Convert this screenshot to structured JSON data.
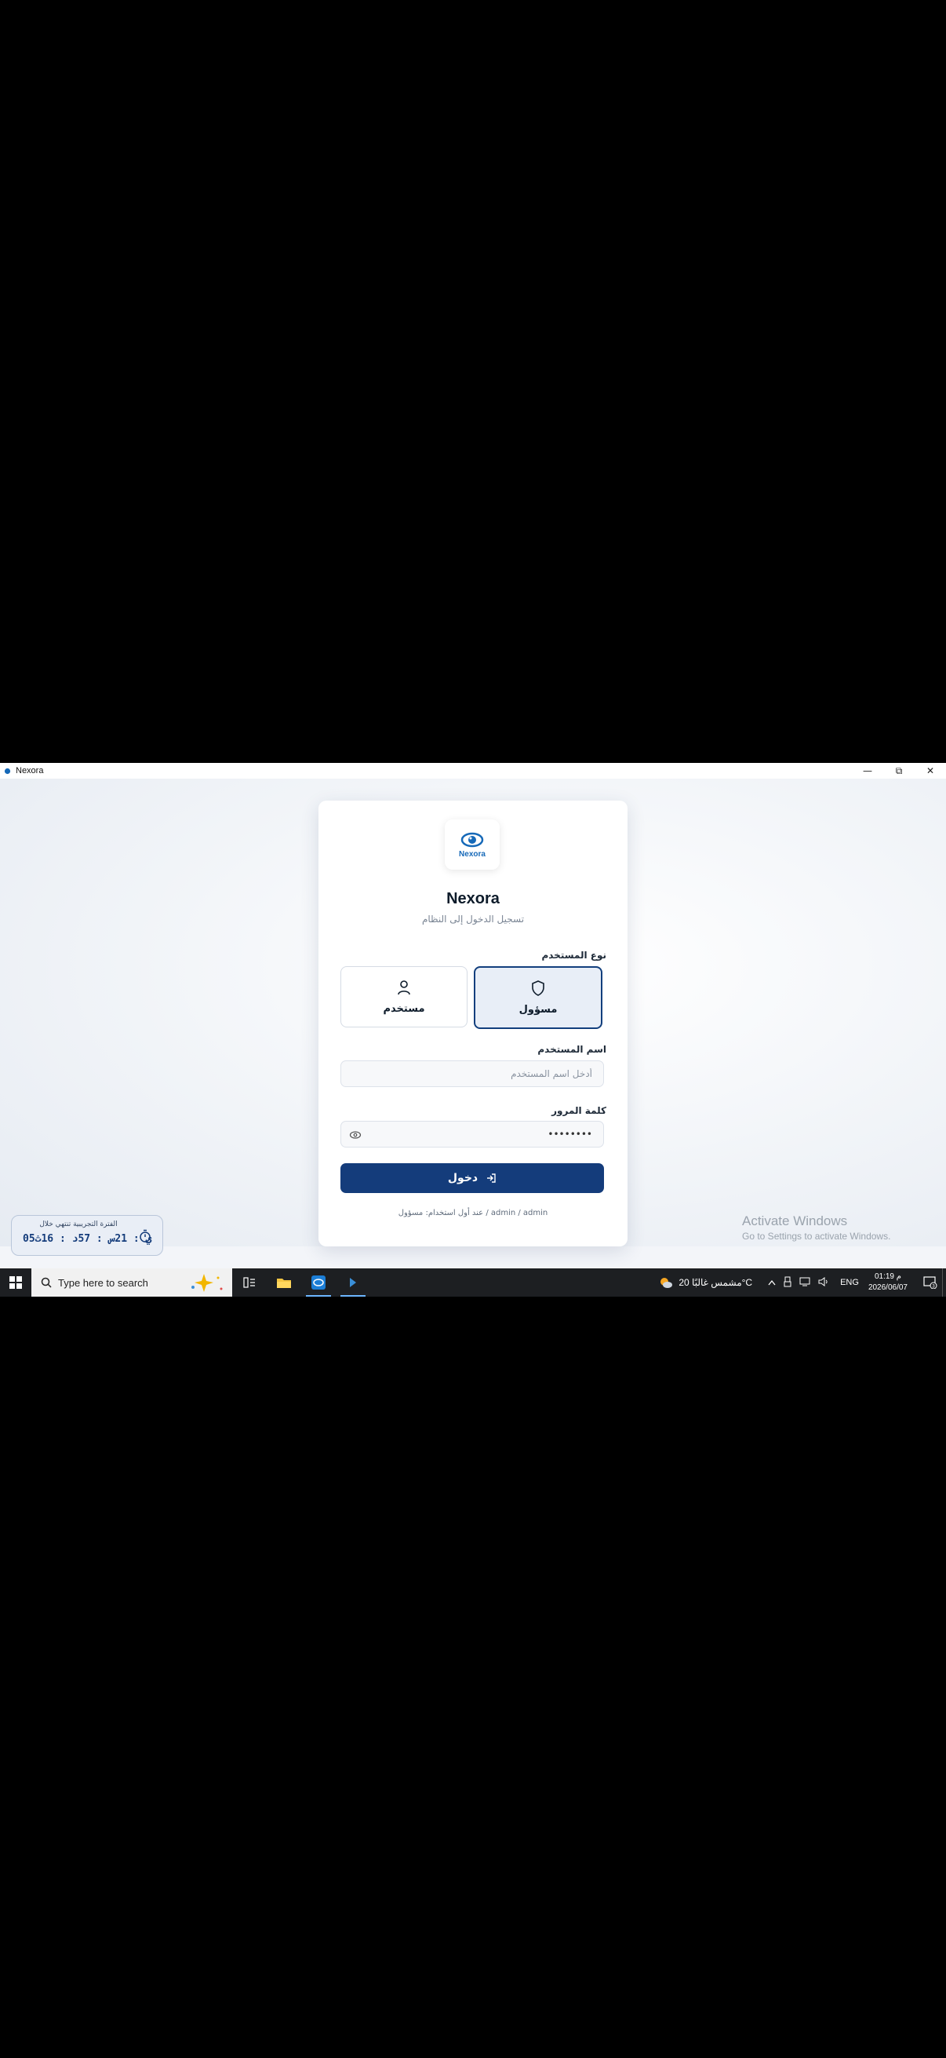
{
  "window": {
    "title": "Nexora",
    "minimize": "—",
    "maximize": "⧉",
    "close": "✕"
  },
  "brand": {
    "logo_text": "Nexora",
    "app_name": "Nexora",
    "subtitle": "تسجيل الدخول إلى النظام"
  },
  "user_type": {
    "label": "نوع المستخدم",
    "options": [
      {
        "label": "مسؤول",
        "icon": "shield-icon",
        "selected": true
      },
      {
        "label": "مستخدم",
        "icon": "user-icon",
        "selected": false
      }
    ]
  },
  "username": {
    "label": "اسم المستخدم",
    "placeholder": "أدخل اسم المستخدم",
    "value": ""
  },
  "password": {
    "label": "كلمة المرور",
    "value": "••••••••"
  },
  "login_button": {
    "label": "دخول"
  },
  "hint": "عند أول استخدام: مسؤول / admin / admin",
  "trial": {
    "title": "الفترة التجريبية تنتهي خلال",
    "countdown": "05ي : 21س : 57د : 16ث"
  },
  "activate_windows": {
    "line1": "Activate Windows",
    "line2": "Go to Settings to activate Windows."
  },
  "taskbar": {
    "search_placeholder": "Type here to search",
    "weather": "مشمس غالبًا 20°C",
    "language": "ENG",
    "time": "01:19 م",
    "date": "2026/06/07",
    "notifications": "3"
  },
  "colors": {
    "primary": "#143c7b",
    "accent": "#1669b8",
    "background": "#f3f5f9"
  }
}
